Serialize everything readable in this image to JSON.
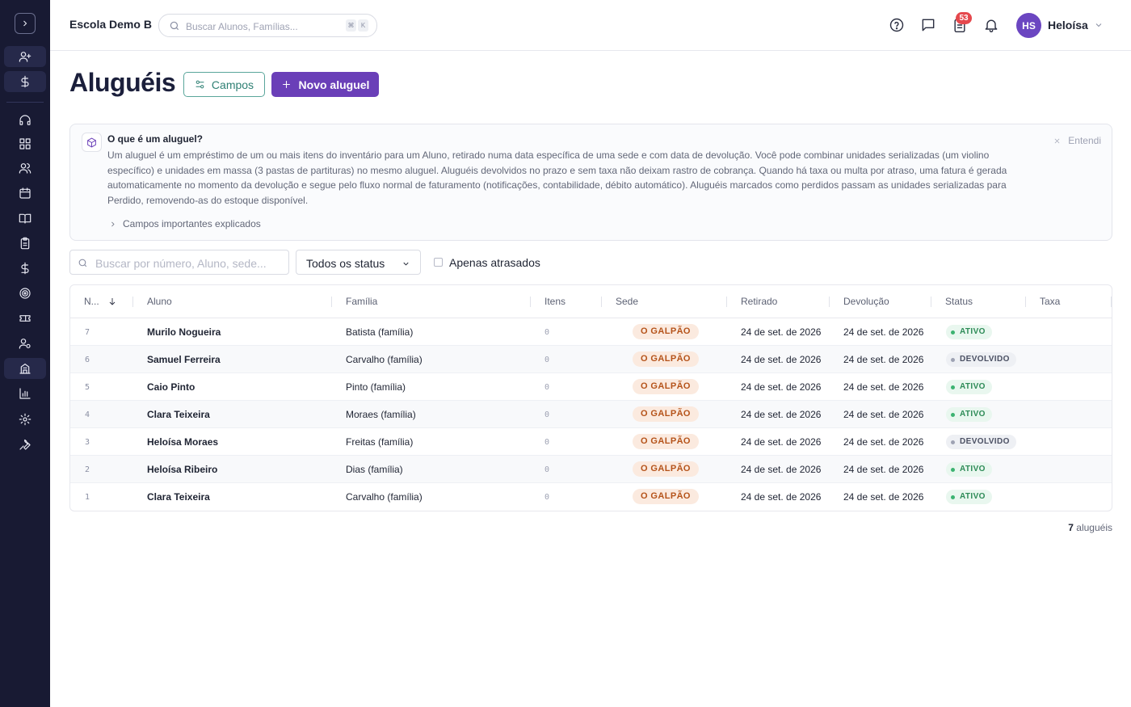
{
  "topbar": {
    "school": "Escola Demo B",
    "search_placeholder": "Buscar Alunos, Famílias...",
    "kbd": [
      "⌘",
      "K"
    ],
    "notif_count": "53",
    "avatar_initials": "HS",
    "user_name": "Heloísa"
  },
  "page": {
    "title": "Aluguéis",
    "campos_label": "Campos",
    "novo_label": "Novo aluguel"
  },
  "info": {
    "title": "O que é um aluguel?",
    "body": "Um aluguel é um empréstimo de um ou mais itens do inventário para um Aluno, retirado numa data específica de uma sede e com data de devolução. Você pode combinar unidades serializadas (um violino específico) e unidades em massa (3 pastas de partituras) no mesmo aluguel. Aluguéis devolvidos no prazo e sem taxa não deixam rastro de cobrança. Quando há taxa ou multa por atraso, uma fatura é gerada automaticamente no momento da devolução e segue pelo fluxo normal de faturamento (notificações, contabilidade, débito automático). Aluguéis marcados como perdidos passam as unidades serializadas para Perdido, removendo-as do estoque disponível.",
    "more": "Campos importantes explicados",
    "dismiss": "Entendi"
  },
  "filters": {
    "search_placeholder": "Buscar por número, Aluno, sede...",
    "status_value": "Todos os status",
    "overdue_label": "Apenas atrasados"
  },
  "table": {
    "headers": [
      "N...",
      "Aluno",
      "Família",
      "Itens",
      "Sede",
      "Retirado",
      "Devolução",
      "Status",
      "Taxa"
    ],
    "rows": [
      {
        "num": "7",
        "aluno": "Murilo Nogueira",
        "familia": "Batista (família)",
        "itens": "0",
        "sede": "O GALPÃO",
        "retirado": "24 de set. de 2026",
        "devolucao": "24 de set. de 2026",
        "status": "ATIVO",
        "taxa": ""
      },
      {
        "num": "6",
        "aluno": "Samuel Ferreira",
        "familia": "Carvalho (família)",
        "itens": "0",
        "sede": "O GALPÃO",
        "retirado": "24 de set. de 2026",
        "devolucao": "24 de set. de 2026",
        "status": "DEVOLVIDO",
        "taxa": ""
      },
      {
        "num": "5",
        "aluno": "Caio Pinto",
        "familia": "Pinto (família)",
        "itens": "0",
        "sede": "O GALPÃO",
        "retirado": "24 de set. de 2026",
        "devolucao": "24 de set. de 2026",
        "status": "ATIVO",
        "taxa": ""
      },
      {
        "num": "4",
        "aluno": "Clara Teixeira",
        "familia": "Moraes (família)",
        "itens": "0",
        "sede": "O GALPÃO",
        "retirado": "24 de set. de 2026",
        "devolucao": "24 de set. de 2026",
        "status": "ATIVO",
        "taxa": ""
      },
      {
        "num": "3",
        "aluno": "Heloísa Moraes",
        "familia": "Freitas (família)",
        "itens": "0",
        "sede": "O GALPÃO",
        "retirado": "24 de set. de 2026",
        "devolucao": "24 de set. de 2026",
        "status": "DEVOLVIDO",
        "taxa": ""
      },
      {
        "num": "2",
        "aluno": "Heloísa Ribeiro",
        "familia": "Dias (família)",
        "itens": "0",
        "sede": "O GALPÃO",
        "retirado": "24 de set. de 2026",
        "devolucao": "24 de set. de 2026",
        "status": "ATIVO",
        "taxa": ""
      },
      {
        "num": "1",
        "aluno": "Clara Teixeira",
        "familia": "Carvalho (família)",
        "itens": "0",
        "sede": "O GALPÃO",
        "retirado": "24 de set. de 2026",
        "devolucao": "24 de set. de 2026",
        "status": "ATIVO",
        "taxa": ""
      }
    ]
  },
  "footer": {
    "count": "7",
    "count_label": "aluguéis"
  },
  "colors": {
    "sidebar": "#181a33",
    "primary": "#6a3fb8",
    "teal": "#2f8074",
    "sede_badge": "#fbeadf",
    "ativo": "#2e8b57"
  },
  "icons": {
    "sidebar": [
      "chevron-right-icon",
      "user-plus-icon",
      "dollar-icon",
      "headset-icon",
      "grid-icon",
      "users-icon",
      "calendar-icon",
      "book-icon",
      "clipboard-icon",
      "dollar-icon",
      "target-icon",
      "ticket-icon",
      "user-cog-icon",
      "building-icon",
      "bar-chart-icon",
      "gear-icon",
      "wrench-icon"
    ],
    "topbar": [
      "help-icon",
      "chat-icon",
      "clipboard-icon",
      "bell-icon",
      "chevron-down-icon"
    ]
  }
}
